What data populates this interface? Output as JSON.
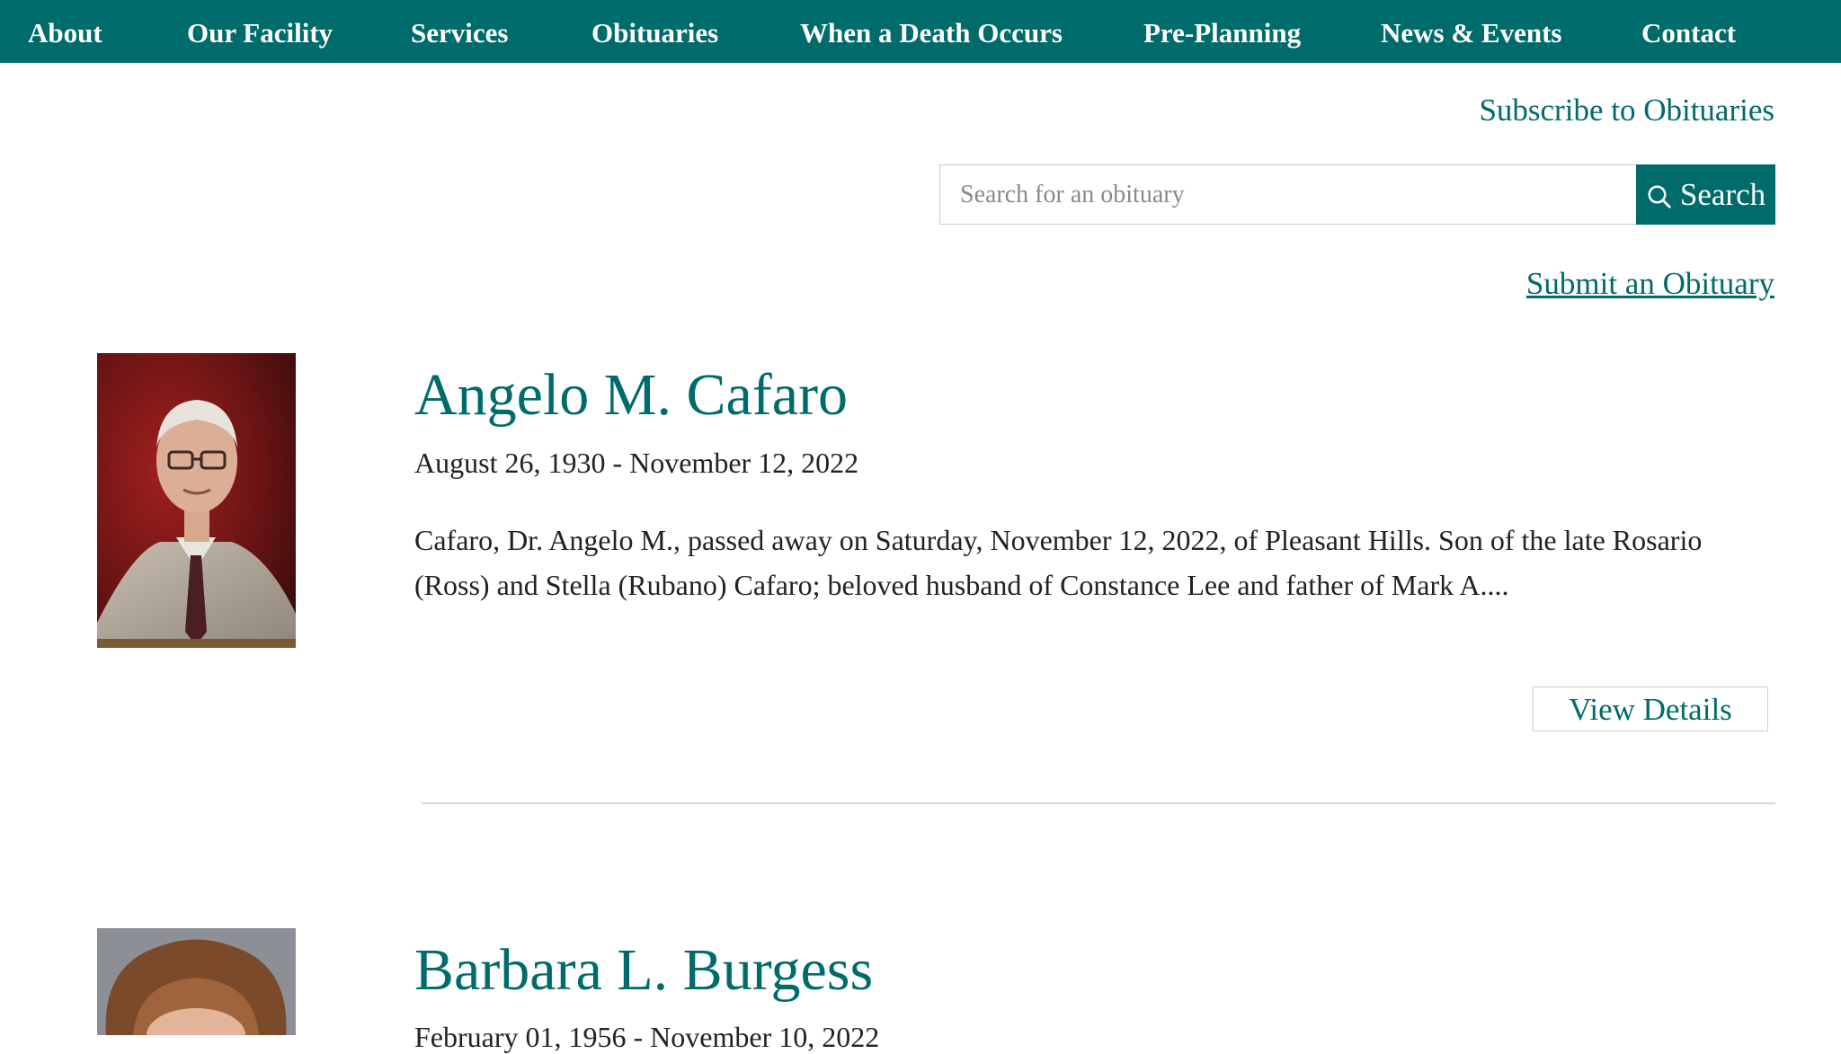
{
  "nav": {
    "items": [
      {
        "label": "About"
      },
      {
        "label": "Our Facility"
      },
      {
        "label": "Services"
      },
      {
        "label": "Obituaries"
      },
      {
        "label": "When a Death Occurs"
      },
      {
        "label": "Pre-Planning"
      },
      {
        "label": "News & Events"
      },
      {
        "label": "Contact"
      }
    ]
  },
  "subscribe_label": "Subscribe to Obituaries",
  "search": {
    "placeholder": "Search for an obituary",
    "button_label": "Search",
    "button_icon": "search-icon"
  },
  "submit_label": "Submit an Obituary",
  "obituaries": [
    {
      "name": "Angelo M. Cafaro",
      "dates": "August 26, 1930 - November 12, 2022",
      "excerpt": "Cafaro, Dr. Angelo M., passed away on Saturday, November 12, 2022, of Pleasant Hills. Son of the late Rosario (Ross) and Stella (Rubano) Cafaro; beloved husband of Constance Lee and father of Mark A....",
      "view_label": "View Details"
    },
    {
      "name": "Barbara L. Burgess",
      "dates": "February 01, 1956 - November 10, 2022"
    }
  ],
  "colors": {
    "brand": "#006b6b",
    "text": "#222222",
    "divider": "#d6d6d6"
  }
}
